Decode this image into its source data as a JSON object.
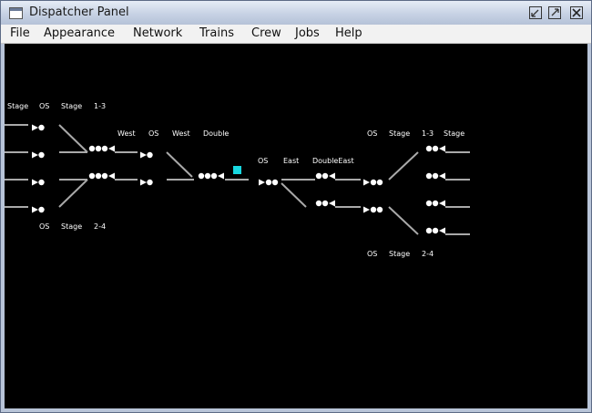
{
  "window": {
    "title": "Dispatcher Panel"
  },
  "icons": [
    "app-icon",
    "minimize-icon",
    "maximize-icon",
    "close-icon"
  ],
  "menu": [
    "File",
    "Appearance",
    "Network",
    "Trains",
    "Crew",
    "Jobs",
    "Help"
  ],
  "panel": {
    "background": "#000000",
    "indicator_color": "#18d8e0",
    "labels": {
      "l_stage_top": "Stage",
      "l_os_top": "OS",
      "l_stage13": "Stage",
      "l_13": "1-3",
      "l_west1": "West",
      "l_os_w": "OS",
      "l_west2": "West",
      "l_double": "Double",
      "l_os_e": "OS",
      "l_east": "East",
      "l_doubleeast": "DoubleEast",
      "l_os_r": "OS",
      "l_stage_r": "Stage",
      "l_13_r": "1-3",
      "l_stage_r2": "Stage",
      "l_os_bl": "OS",
      "l_stage_bl": "Stage",
      "l_24_bl": "2-4",
      "l_os_br": "OS",
      "l_stage_br": "Stage",
      "l_24_br": "2-4"
    }
  }
}
